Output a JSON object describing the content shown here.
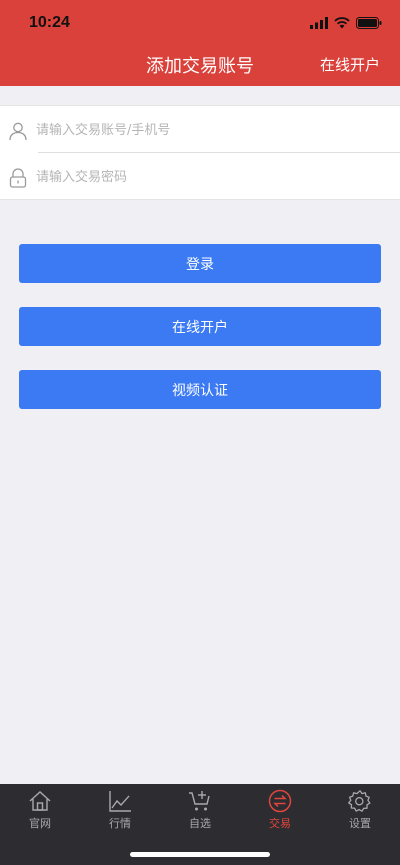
{
  "status_bar": {
    "time": "10:24"
  },
  "header": {
    "title": "添加交易账号",
    "right_link": "在线开户"
  },
  "form": {
    "account_placeholder": "请输入交易账号/手机号",
    "password_placeholder": "请输入交易密码"
  },
  "buttons": {
    "login": "登录",
    "open_account": "在线开户",
    "video_verify": "视频认证"
  },
  "tabbar": {
    "items": [
      {
        "label": "官网",
        "icon": "home-icon"
      },
      {
        "label": "行情",
        "icon": "chart-icon"
      },
      {
        "label": "自选",
        "icon": "cart-icon"
      },
      {
        "label": "交易",
        "icon": "exchange-icon",
        "active": true
      },
      {
        "label": "设置",
        "icon": "gear-icon"
      }
    ]
  },
  "colors": {
    "header": "#d9413a",
    "button": "#3b7af2",
    "tabbar": "#2d2d31",
    "active_tab": "#e2453d"
  }
}
